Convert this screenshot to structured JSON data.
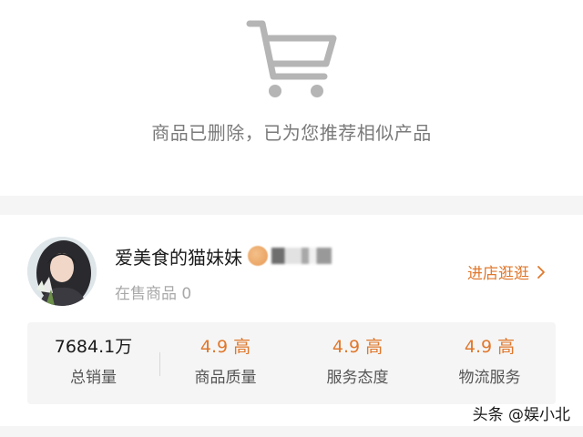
{
  "deleted_notice": {
    "icon": "shopping-cart-icon",
    "message": "商品已删除，已为您推荐相似产品"
  },
  "shop": {
    "name": "爱美食的猫妹妹",
    "on_sale_label": "在售商品 0",
    "visit_label": "进店逛逛",
    "visit_icon": "chevron-right-icon",
    "accent_color": "#e0782c",
    "stats": [
      {
        "value": "7684.1万",
        "label": "总销量"
      },
      {
        "value": "4.9 高",
        "label": "商品质量"
      },
      {
        "value": "4.9 高",
        "label": "服务态度"
      },
      {
        "value": "4.9 高",
        "label": "物流服务"
      }
    ]
  },
  "watermark": "头条 @娱小北"
}
